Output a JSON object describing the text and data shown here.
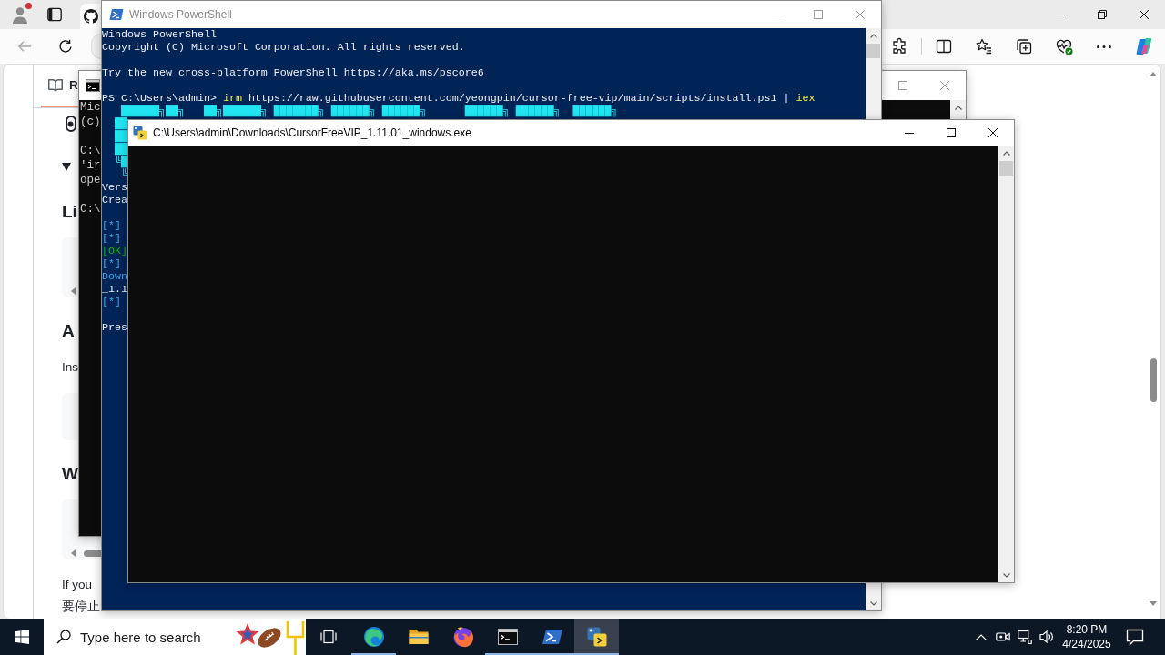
{
  "browser": {
    "tab": {
      "selected": true
    },
    "back_button": {
      "disabled": true
    },
    "page": {
      "readme_tab": {
        "label": "R",
        "selected": true
      },
      "details": {
        "expanded": true
      },
      "blocks": [
        {
          "kind": "heading",
          "text": "Li"
        },
        {
          "kind": "code",
          "scroll_arrow": true
        },
        {
          "kind": "heading",
          "text": "A"
        },
        {
          "kind": "text",
          "lines": [
            "Ins"
          ]
        },
        {
          "kind": "code",
          "scroll_arrow": false
        },
        {
          "kind": "heading",
          "text": "W"
        },
        {
          "kind": "code",
          "scroll_arrow": true,
          "scroll_thumb": true
        },
        {
          "kind": "text",
          "lines": [
            "If you",
            "要停止"
          ]
        }
      ]
    }
  },
  "cmd_window": {
    "lines": [
      {
        "kind": "text",
        "text": "Mic"
      },
      {
        "kind": "text",
        "text": "(c)"
      },
      {
        "kind": "blank"
      },
      {
        "kind": "text",
        "text": "C:\\"
      },
      {
        "kind": "text",
        "text": "'ir"
      },
      {
        "kind": "text",
        "text": "ope"
      },
      {
        "kind": "blank"
      },
      {
        "kind": "text",
        "text": "C:\\"
      }
    ]
  },
  "powershell_window": {
    "title": "Windows PowerShell",
    "active": false,
    "lines": [
      {
        "kind": "plain",
        "text": "Windows PowerShell"
      },
      {
        "kind": "plain",
        "text": "Copyright (C) Microsoft Corporation. All rights reserved."
      },
      {
        "kind": "blank"
      },
      {
        "kind": "plain",
        "text": "Try the new cross-platform PowerShell https://aka.ms/pscore6"
      },
      {
        "kind": "blank"
      },
      {
        "kind": "command",
        "segments": [
          {
            "kind": "plain",
            "text": "PS C:\\Users\\admin> "
          },
          {
            "kind": "keyword",
            "text": "irm"
          },
          {
            "kind": "plain",
            "text": " https://raw.githubusercontent.com/yeongpin/cursor-free-vip/main/scripts/install.ps1 | "
          },
          {
            "kind": "keyword",
            "text": "iex"
          }
        ]
      },
      {
        "kind": "banner",
        "text": "   ██████╗██╗   ██╗██████╗ ███████╗ ██████╗ ██████╗      ██████╗ ██████╗  ██████╗"
      },
      {
        "kind": "banner",
        "text": "  ██"
      },
      {
        "kind": "banner",
        "text": "  ██"
      },
      {
        "kind": "banner",
        "text": "  ██"
      },
      {
        "kind": "banner",
        "text": "  ╚█"
      },
      {
        "kind": "banner",
        "text": "   ╚"
      },
      {
        "kind": "plain",
        "text": "Vers"
      },
      {
        "kind": "plain",
        "text": "Crea"
      },
      {
        "kind": "blank"
      },
      {
        "kind": "info",
        "text": "[*]"
      },
      {
        "kind": "info",
        "text": "[*]"
      },
      {
        "kind": "ok",
        "text": "[OK]"
      },
      {
        "kind": "info",
        "text": "[*]"
      },
      {
        "kind": "info",
        "text": "Down"
      },
      {
        "kind": "plain",
        "text": "_1.1"
      },
      {
        "kind": "info",
        "text": "[*]"
      },
      {
        "kind": "blank"
      },
      {
        "kind": "plain",
        "text": "Pres"
      }
    ]
  },
  "app_window": {
    "title": "C:\\Users\\admin\\Downloads\\CursorFreeVIP_1.11.01_windows.exe",
    "active": true
  },
  "taskbar": {
    "search": {
      "placeholder": "Type here to search"
    },
    "apps": [
      {
        "running": true,
        "selected": false
      },
      {
        "running": false,
        "selected": false
      },
      {
        "running": false,
        "selected": false
      },
      {
        "running": true,
        "selected": false
      },
      {
        "running": true,
        "selected": false
      },
      {
        "running": true,
        "selected": true
      }
    ],
    "clock": {
      "time": "8:20 PM",
      "date": "4/24/2025"
    }
  }
}
